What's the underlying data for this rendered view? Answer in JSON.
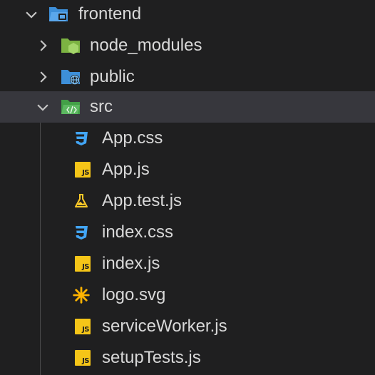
{
  "explorer": {
    "root": {
      "label": "frontend",
      "icon": "folder-open-icon",
      "expanded": true
    },
    "folders": [
      {
        "label": "node_modules",
        "icon": "node-folder-icon",
        "expanded": false
      },
      {
        "label": "public",
        "icon": "public-folder-icon",
        "expanded": false
      },
      {
        "label": "src",
        "icon": "src-folder-icon",
        "expanded": true
      }
    ],
    "files": [
      {
        "label": "App.css",
        "icon": "css-file-icon"
      },
      {
        "label": "App.js",
        "icon": "js-file-icon"
      },
      {
        "label": "App.test.js",
        "icon": "test-file-icon"
      },
      {
        "label": "index.css",
        "icon": "css-file-icon"
      },
      {
        "label": "index.js",
        "icon": "js-file-icon"
      },
      {
        "label": "logo.svg",
        "icon": "svg-file-icon"
      },
      {
        "label": "serviceWorker.js",
        "icon": "js-file-icon"
      },
      {
        "label": "setupTests.js",
        "icon": "js-file-icon"
      }
    ],
    "selected": "src",
    "js_badge_text": "JS",
    "colors": {
      "background": "#1f1f20",
      "selected_row": "#37373d",
      "text": "#d8d8d8",
      "folder_blue": "#3d8fd9",
      "node_green": "#8bc34a",
      "src_green": "#4caf50",
      "css_blue": "#42a5f5",
      "js_yellow": "#f5c518",
      "test_yellow": "#ffca28",
      "svg_orange": "#ffb300"
    }
  }
}
